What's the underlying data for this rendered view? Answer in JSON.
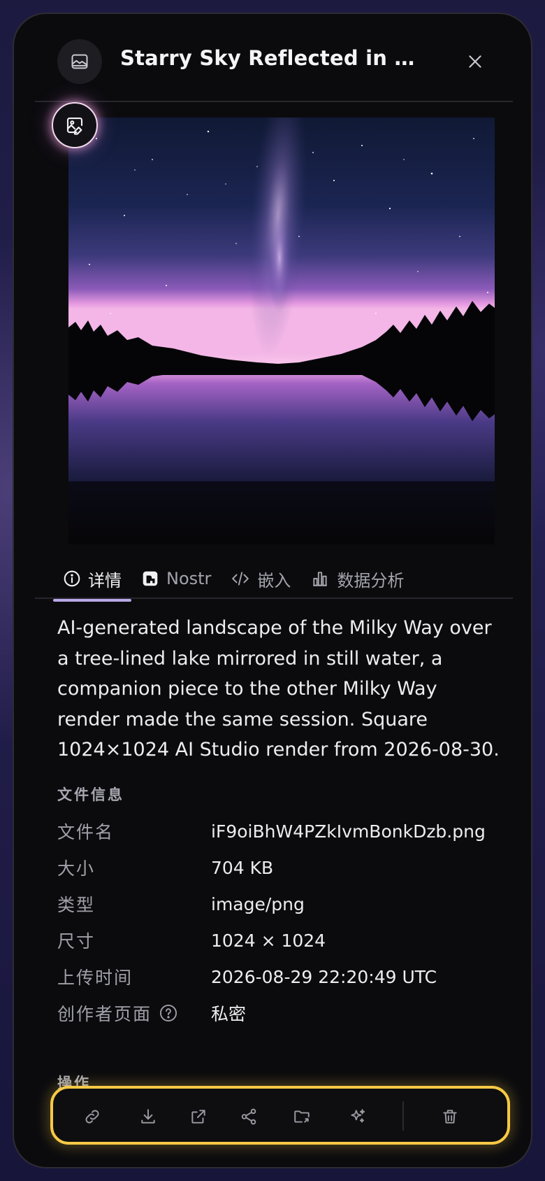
{
  "header": {
    "title": "Starry Sky Reflected in a F...",
    "icon": "image-icon",
    "close_icon": "close-icon"
  },
  "image": {
    "alt": "Starry Sky Reflected in a Forest Lake",
    "edit_icon": "image-edit-icon"
  },
  "tabs": [
    {
      "label": "详情",
      "icon": "info-icon",
      "active": true
    },
    {
      "label": "Nostr",
      "icon": "nostr-icon",
      "active": false
    },
    {
      "label": "嵌入",
      "icon": "code-icon",
      "active": false
    },
    {
      "label": "数据分析",
      "icon": "bar-chart-icon",
      "active": false
    }
  ],
  "description": "AI-generated landscape of the Milky Way over a tree-lined lake mirrored in still water, a companion piece to the other Milky Way render made the same session. Square 1024×1024 AI Studio render from 2026-08-30.",
  "file_info": {
    "heading": "文件信息",
    "rows": [
      {
        "key": "文件名",
        "value": "iF9oiBhW4PZkIvmBonkDzb.png"
      },
      {
        "key": "大小",
        "value": "704 KB"
      },
      {
        "key": "类型",
        "value": "image/png"
      },
      {
        "key": "尺寸",
        "value": "1024 × 1024"
      },
      {
        "key": "上传时间",
        "value": "2026-08-29 22:20:49 UTC"
      },
      {
        "key": "创作者页面",
        "value": "私密"
      }
    ]
  },
  "actions": {
    "heading": "操作",
    "items": [
      "link-icon",
      "download-icon",
      "external-link-icon",
      "share-icon",
      "folder-move-icon",
      "sparkles-icon",
      "trash-icon"
    ]
  },
  "colors": {
    "accent_tab": "#b9a8e8",
    "highlight_border": "#f6c944",
    "modal_bg": "#0b0b0e"
  }
}
